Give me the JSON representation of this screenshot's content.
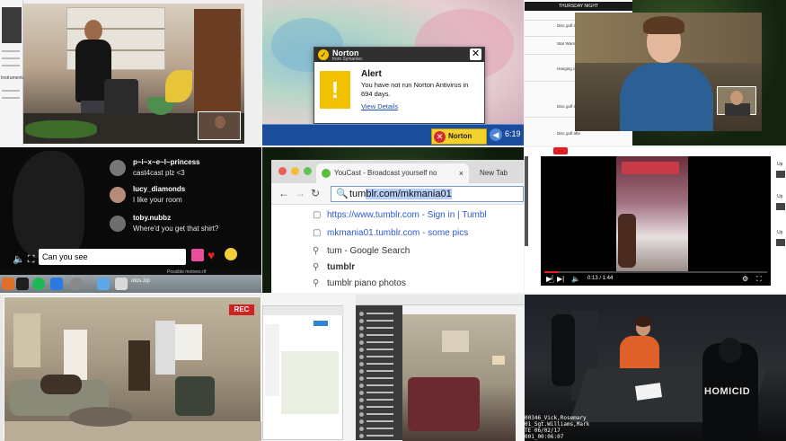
{
  "tile1": {
    "side_label": "Instrumental"
  },
  "tile2": {
    "popup": {
      "brand": "Norton",
      "sub": "from Symantec",
      "title": "Alert",
      "message": "You have not run Norton Antivirus in 694 days.",
      "link": "View Details",
      "close": "✕",
      "warning_glyph": "!"
    },
    "taskbar": {
      "tray_label": "Norton",
      "tray_icon": "✕",
      "clock": "6:19"
    }
  },
  "tile3": {
    "doc": {
      "header": "THURSDAY NIGHT",
      "items": [
        "Disc golf afte",
        "Star Wars M",
        "Hanging out with Rebe",
        "Disc golf afte",
        "Disc golf afte"
      ]
    }
  },
  "tile4": {
    "messages": [
      {
        "user": "p~i~x~e~l~princess",
        "text": "cast4cast plz <3",
        "avatar_color": "#777777"
      },
      {
        "user": "lucy_diamonds",
        "text": "I like your room",
        "avatar_color": "#b88a78"
      },
      {
        "user": "toby.nubbz",
        "text": "Where'd you get that shirt?",
        "avatar_color": "#6e6e6e"
      }
    ],
    "input_value": "Can you see ",
    "controls": "🔈 ⛶",
    "heart": "♥",
    "ghost_text": "Possible motives.rtf",
    "dock_file": "otos.zip"
  },
  "tile5": {
    "tab_title": "YouCast - Broadcast yourself no",
    "tab_close": "×",
    "tab2_title": "New Tab",
    "nav": {
      "back": "←",
      "forward": "→",
      "reload": "↻"
    },
    "omnibox": {
      "typed": "tum",
      "selected": "blr.com/mkmania01",
      "icon": "🔍"
    },
    "suggestions": [
      {
        "text": "https://www.tumblr.com - Sign in | Tumbl",
        "icon": "▢",
        "kind": "link"
      },
      {
        "text": "mkmania01.tumblr.com - some pics",
        "icon": "▢",
        "kind": "link"
      },
      {
        "text": "tum - Google Search",
        "icon": "⚲",
        "kind": "search"
      },
      {
        "text": "tumblr",
        "icon": "⚲",
        "kind": "search"
      },
      {
        "text": "tumblr piano photos",
        "icon": "⚲",
        "kind": "search"
      }
    ]
  },
  "tile6": {
    "right_col": [
      "Up",
      "Up",
      "Up"
    ],
    "player": {
      "time": "0:13 / 1:44",
      "progress_fraction": 0.065,
      "play": "▶",
      "next": "▶|",
      "volume": "🔈",
      "settings": "⚙",
      "fullscreen": "⛶",
      "cursor": "☝"
    }
  },
  "tile7": {
    "rec_label": "REC"
  },
  "tile8": {},
  "tile9": {
    "vest_label": "HOMICID",
    "timestamp_lines": [
      "00346_Vick,Rosemary",
      "01_Sgt.Williams,Mark",
      "TE 06/02/17",
      "001_00:06:07"
    ]
  }
}
